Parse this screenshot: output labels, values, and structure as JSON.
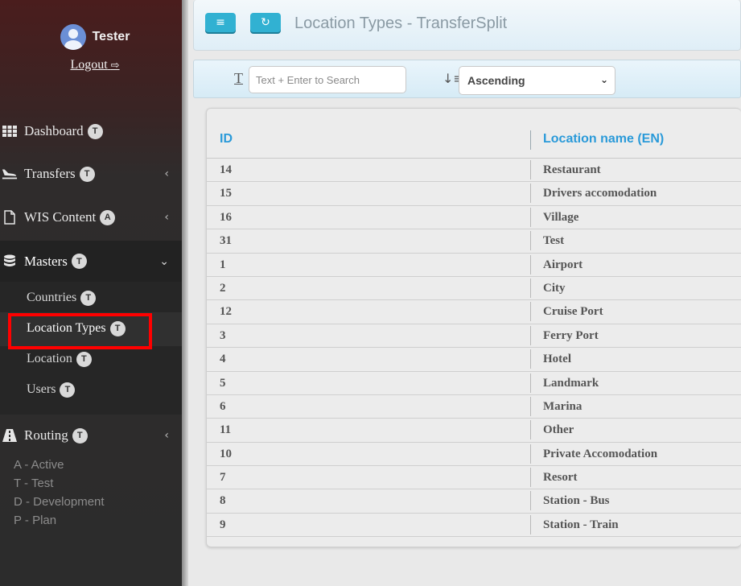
{
  "sidebar": {
    "user_name": "Tester",
    "logout_label": "Logout",
    "nav": {
      "dashboard": {
        "label": "Dashboard",
        "badge": "T"
      },
      "transfers": {
        "label": "Transfers",
        "badge": "T"
      },
      "wis_content": {
        "label": "WIS Content",
        "badge": "A"
      },
      "masters": {
        "label": "Masters",
        "badge": "T"
      },
      "routing": {
        "label": "Routing",
        "badge": "T"
      }
    },
    "masters_items": [
      {
        "label": "Countries",
        "badge": "T"
      },
      {
        "label": "Location Types",
        "badge": "T"
      },
      {
        "label": "Location",
        "badge": "T"
      },
      {
        "label": "Users",
        "badge": "T"
      }
    ],
    "legend": [
      "A - Active",
      "T - Test",
      "D - Development",
      "P - Plan"
    ]
  },
  "header": {
    "title": "Location Types - TransferSplit"
  },
  "filters": {
    "search_placeholder": "Text + Enter to Search",
    "sort_value": "Ascending"
  },
  "table": {
    "columns": [
      "ID",
      "Location name (EN)"
    ],
    "rows": [
      {
        "id": "14",
        "name": "Restaurant"
      },
      {
        "id": "15",
        "name": "Drivers accomodation"
      },
      {
        "id": "16",
        "name": "Village"
      },
      {
        "id": "31",
        "name": "Test"
      },
      {
        "id": "1",
        "name": "Airport"
      },
      {
        "id": "2",
        "name": "City"
      },
      {
        "id": "12",
        "name": "Cruise Port"
      },
      {
        "id": "3",
        "name": "Ferry Port"
      },
      {
        "id": "4",
        "name": "Hotel"
      },
      {
        "id": "5",
        "name": "Landmark"
      },
      {
        "id": "6",
        "name": "Marina"
      },
      {
        "id": "11",
        "name": "Other"
      },
      {
        "id": "10",
        "name": "Private Accomodation"
      },
      {
        "id": "7",
        "name": "Resort"
      },
      {
        "id": "8",
        "name": "Station - Bus"
      },
      {
        "id": "9",
        "name": "Station - Train"
      }
    ]
  }
}
